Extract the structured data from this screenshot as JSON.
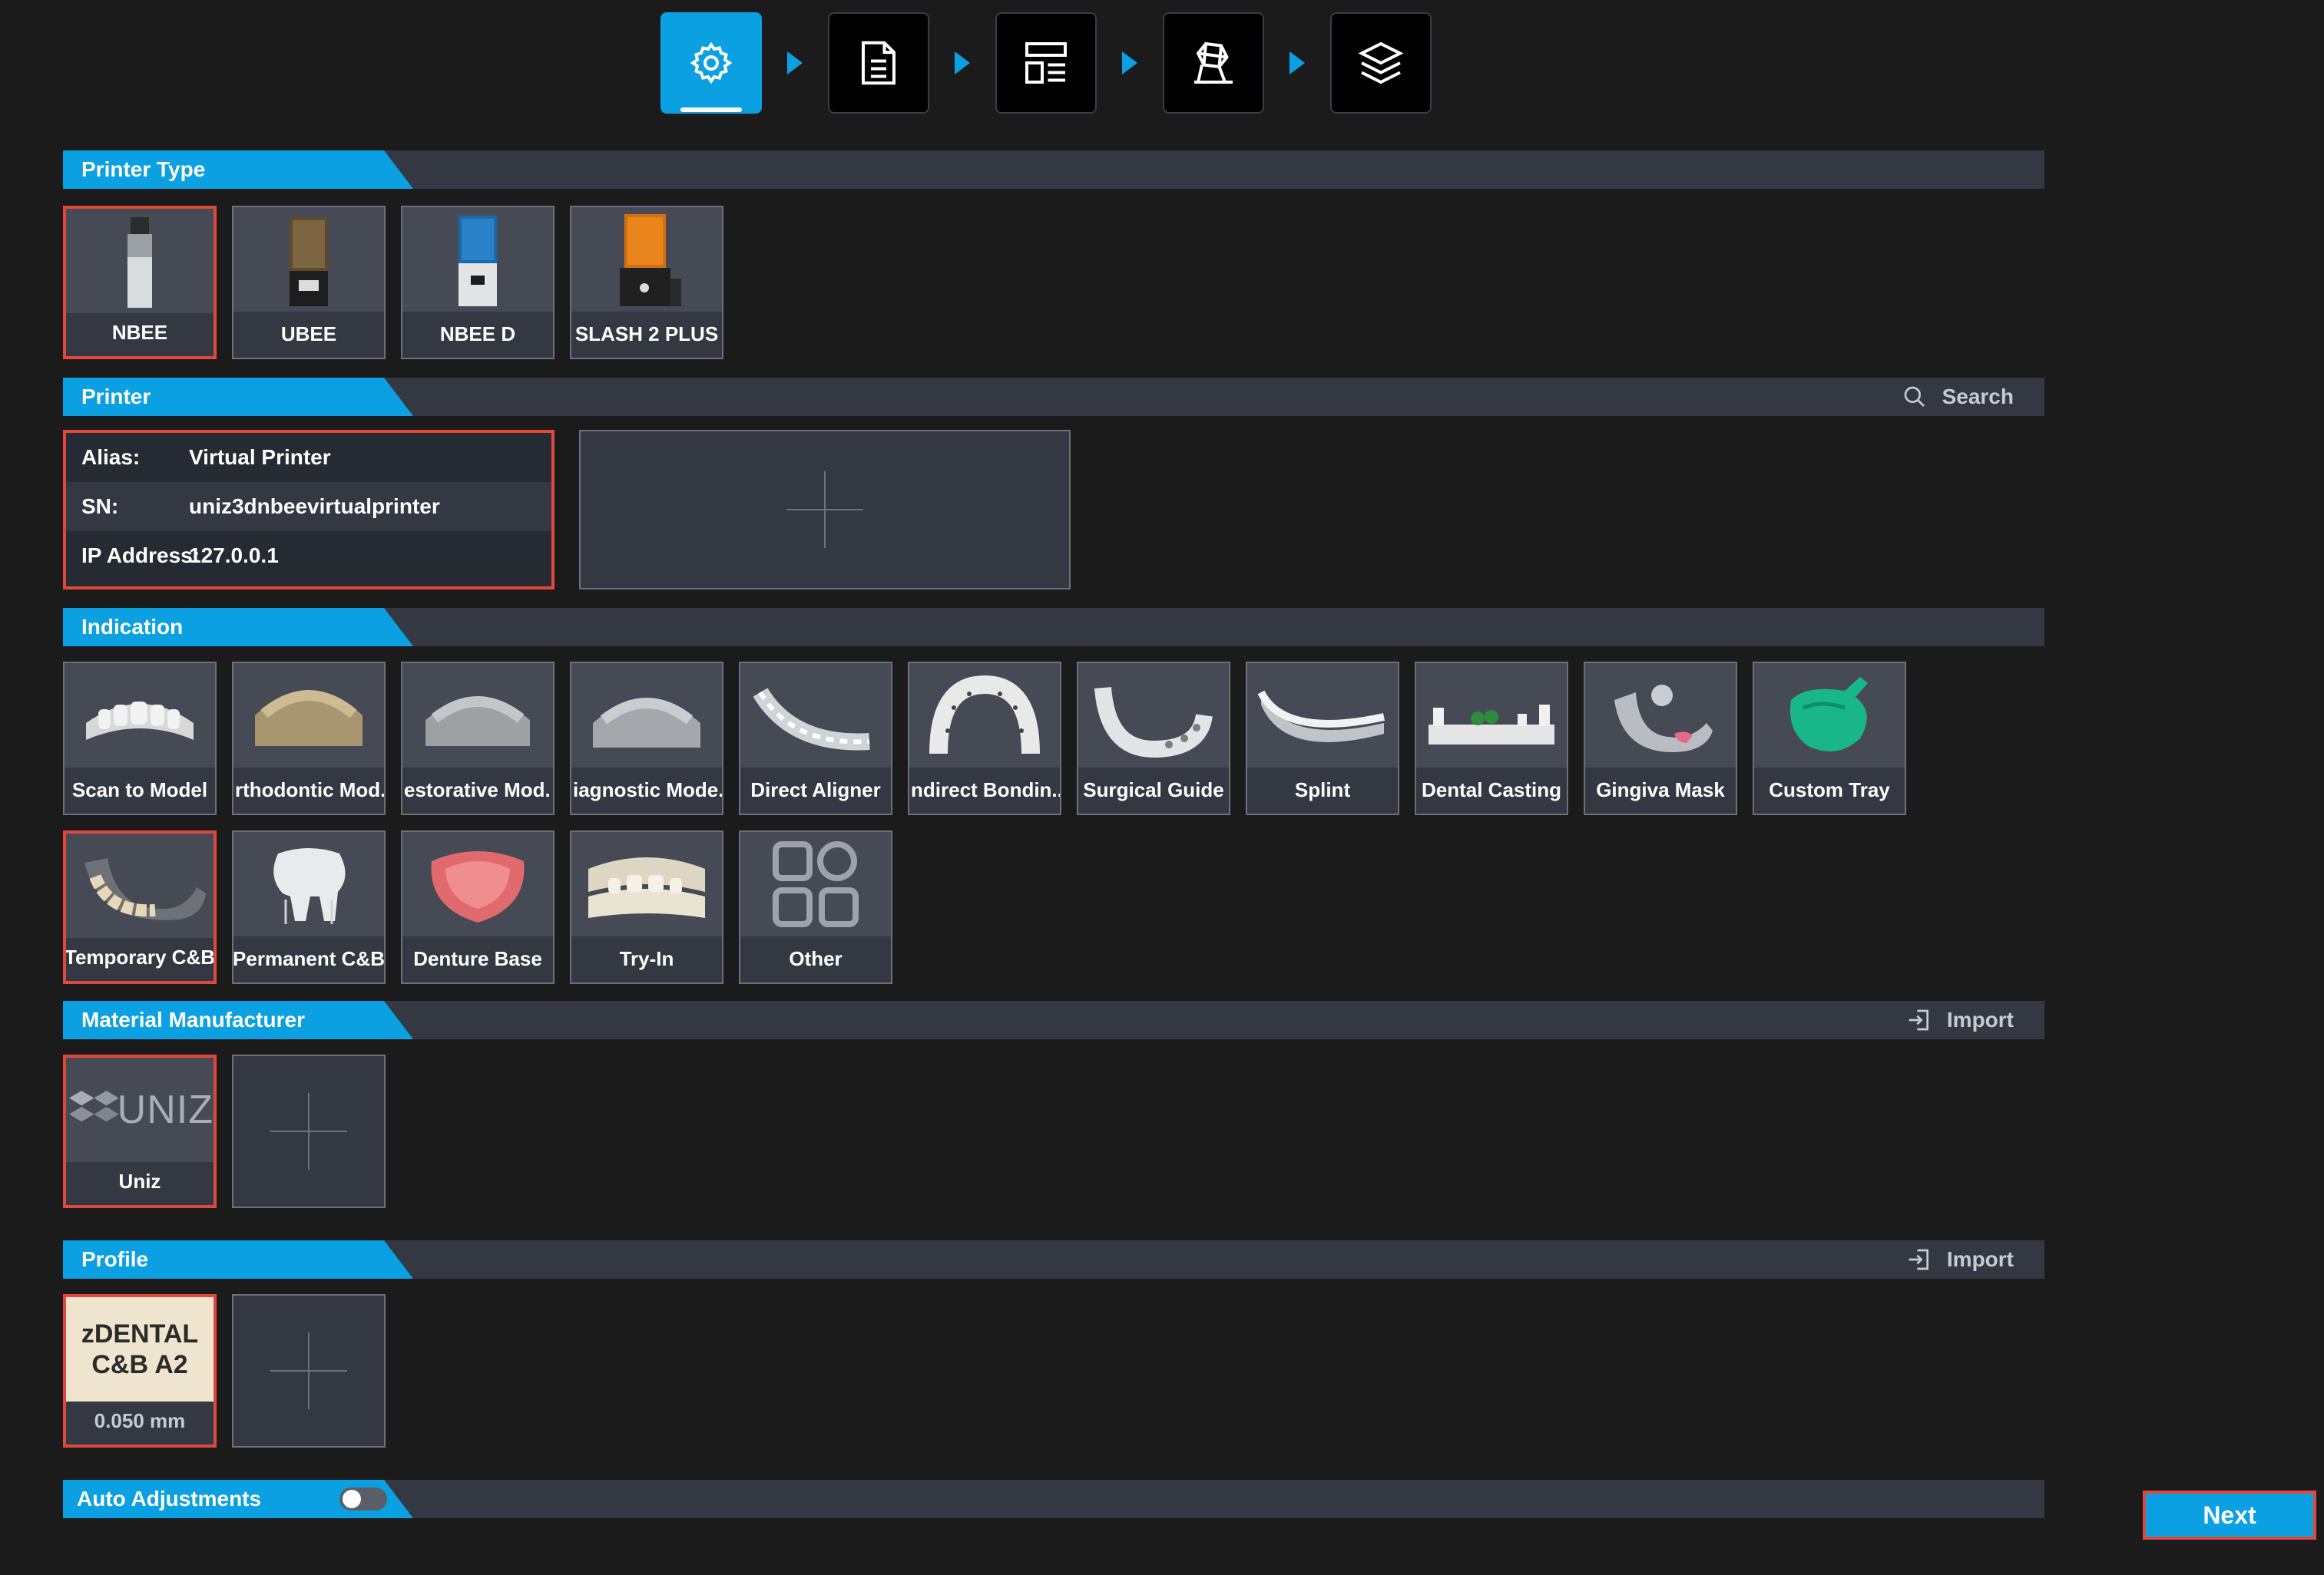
{
  "steps": [
    "settings-icon",
    "document-icon",
    "layout-icon",
    "model-icon",
    "layers-icon"
  ],
  "sections": {
    "printer_type": "Printer Type",
    "printer": "Printer",
    "indication": "Indication",
    "material_manufacturer": "Material Manufacturer",
    "profile": "Profile",
    "auto_adjustments": "Auto Adjustments"
  },
  "actions": {
    "search": "Search",
    "import": "Import"
  },
  "printer_types": [
    "NBEE",
    "UBEE",
    "NBEE D",
    "SLASH 2 PLUS"
  ],
  "printer": {
    "alias_label": "Alias:",
    "alias": "Virtual Printer",
    "sn_label": "SN:",
    "sn": "uniz3dnbeevirtualprinter",
    "ip_label": "IP Address:",
    "ip": "127.0.0.1"
  },
  "indications": [
    "Scan to Model",
    "rthodontic Mod.",
    "estorative Mod.",
    "iagnostic Mode.",
    "Direct Aligner",
    "ndirect Bondin..",
    "Surgical Guide",
    "Splint",
    "Dental Casting",
    "Gingiva Mask",
    "Custom Tray",
    "Temporary C&B",
    "Permanent C&B",
    "Denture Base",
    "Try-In",
    "Other"
  ],
  "manufacturer": {
    "label": "Uniz",
    "logo": "UNIZ"
  },
  "profile": {
    "line1": "zDENTAL",
    "line2": "C&B A2",
    "thickness": "0.050 mm"
  },
  "auto_adjustments_on": false,
  "next": "Next",
  "colors": {
    "accent": "#0aa0e2",
    "selected": "#e0483d",
    "panel": "#343843",
    "bg": "#1b1b1b"
  }
}
